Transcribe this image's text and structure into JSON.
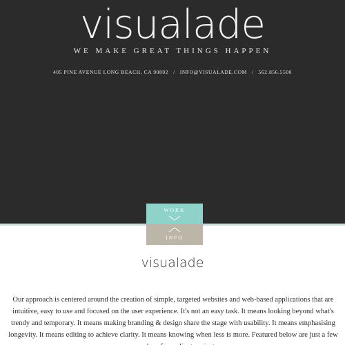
{
  "header": {
    "logo": "visualade",
    "tagline": "WE MAKE GREAT THINGS HAPPEN",
    "address": "405 PINE AVENUE LONG BEACH, CA 90802",
    "separator": "/",
    "email": "INFO@VISUALADE.COM",
    "phone": "562.856.5500"
  },
  "nav": {
    "work_label": "WORK",
    "info_label": "INFO"
  },
  "colors": {
    "hero_bg": "#2b2b2b",
    "work_tab": "#8fd2c9",
    "info_tab": "#bcb6a9",
    "accent_line": "#c9ded7"
  },
  "content": {
    "heading": "visualade",
    "paragraph": "Our approach is centered around the creation of simple, targeted websites and web-based applications that are intuitive, easy to use and focused on the user experience. It's not an easy task. It means looking beyond what's trendy and temporary. It means making branding & design share the stage with usability. It means emphasising longevity. It means editing to achieve clarity. It means knowing when less is more. Featured below are just a few examples of our client projects."
  }
}
